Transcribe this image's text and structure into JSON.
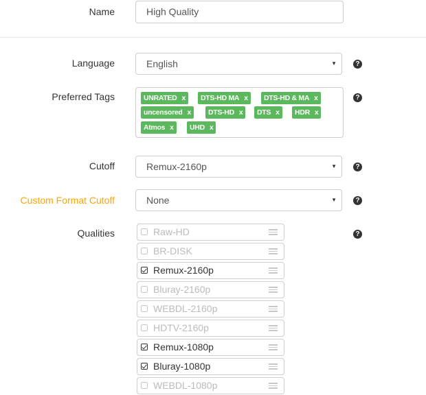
{
  "name": {
    "label": "Name",
    "value": "High Quality"
  },
  "language": {
    "label": "Language",
    "value": "English",
    "help": "?"
  },
  "preferred_tags": {
    "label": "Preferred Tags",
    "help": "?",
    "remove_glyph": "x",
    "tags": [
      "UNRATED",
      "DTS-HD MA",
      "DTS-HD & MA",
      "uncensored",
      "DTS-HD",
      "DTS",
      "HDR",
      "Atmos",
      "UHD"
    ]
  },
  "cutoff": {
    "label": "Cutoff",
    "value": "Remux-2160p",
    "help": "?"
  },
  "custom_format_cutoff": {
    "label": "Custom Format Cutoff",
    "value": "None",
    "help": "?",
    "label_color": "#ffa500"
  },
  "qualities": {
    "label": "Qualities",
    "help": "?",
    "items": [
      {
        "name": "Raw-HD",
        "checked": false
      },
      {
        "name": "BR-DISK",
        "checked": false
      },
      {
        "name": "Remux-2160p",
        "checked": true
      },
      {
        "name": "Bluray-2160p",
        "checked": false
      },
      {
        "name": "WEBDL-2160p",
        "checked": false
      },
      {
        "name": "HDTV-2160p",
        "checked": false
      },
      {
        "name": "Remux-1080p",
        "checked": true
      },
      {
        "name": "Bluray-1080p",
        "checked": true
      },
      {
        "name": "WEBDL-1080p",
        "checked": false
      }
    ]
  },
  "tag_color": "#5cb85c"
}
